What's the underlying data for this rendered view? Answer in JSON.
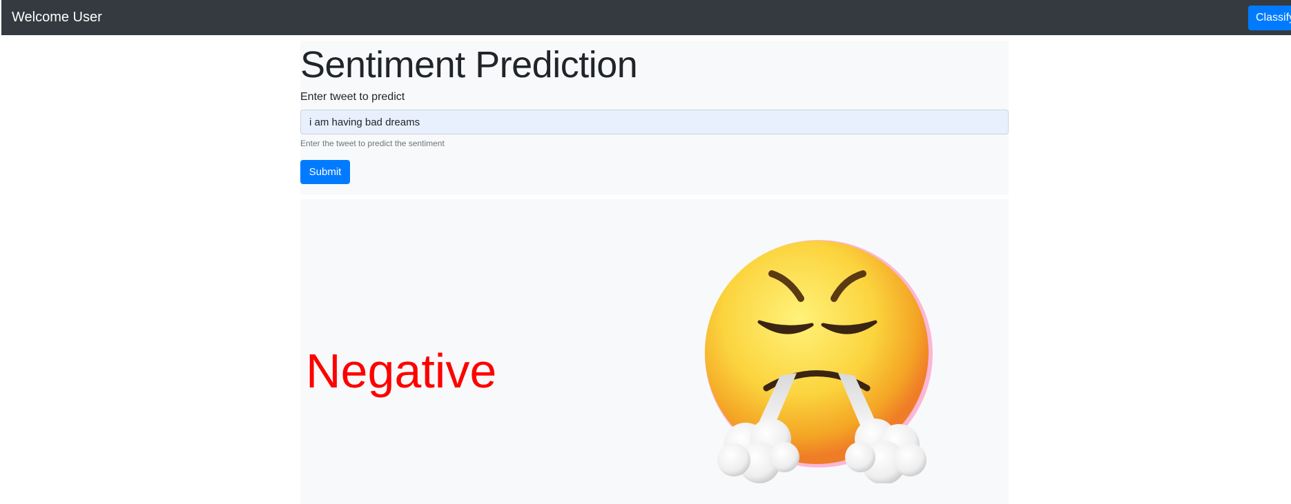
{
  "navbar": {
    "brand": "Welcome User",
    "classify_label": "Classify",
    "background": "#343a40",
    "accent": "#007bff"
  },
  "form": {
    "title": "Sentiment Prediction",
    "input_label": "Enter tweet to predict",
    "input_value": "i am having bad dreams",
    "help_text": "Enter the tweet to predict the sentiment",
    "submit_label": "Submit"
  },
  "result": {
    "sentiment": "Negative",
    "sentiment_color": "#ff0000",
    "emoji_icon": "face-with-steam-from-nose-icon"
  }
}
